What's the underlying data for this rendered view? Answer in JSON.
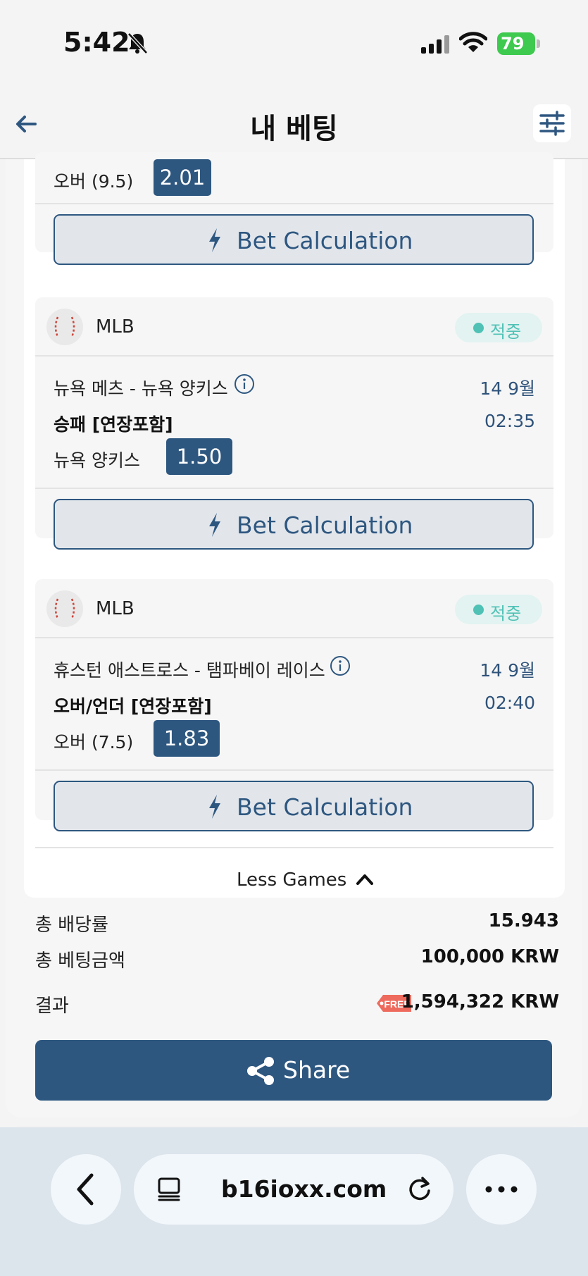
{
  "status_bar": {
    "time": "5:42",
    "battery": "79"
  },
  "header": {
    "title": "내 베팅"
  },
  "partial_game": {
    "pick": "오버 (9.5)",
    "odds": "2.01",
    "calc_label": "Bet Calculation"
  },
  "games": [
    {
      "league": "MLB",
      "status": "적중",
      "teams": "뉴욕 메츠 - 뉴욕 양키스",
      "date": "14 9월",
      "market": "승패 [연장포함]",
      "time": "02:35",
      "pick": "뉴욕 양키스",
      "odds": "1.50",
      "calc_label": "Bet Calculation"
    },
    {
      "league": "MLB",
      "status": "적중",
      "teams": "휴스턴 애스트로스 - 탬파베이 레이스",
      "date": "14 9월",
      "market": "오버/언더 [연장포함]",
      "time": "02:40",
      "pick": "오버 (7.5)",
      "odds": "1.83",
      "calc_label": "Bet Calculation"
    }
  ],
  "less_games": "Less Games",
  "summary": {
    "total_odds_label": "총 배당률",
    "total_odds": "15.943",
    "total_stake_label": "총 베팅금액",
    "total_stake": "100,000 KRW",
    "result_label": "결과",
    "free_tag": "FREE",
    "result": "1,594,322 KRW"
  },
  "share_label": "Share",
  "browser": {
    "url": "b16ioxx.com"
  },
  "colors": {
    "primary": "#2e5780",
    "success": "#4fc1b5",
    "battery": "#3ec94f"
  }
}
